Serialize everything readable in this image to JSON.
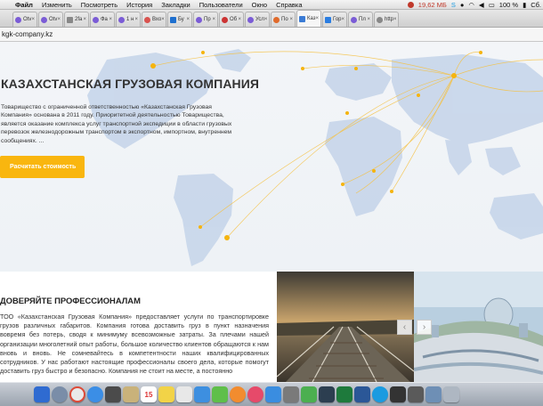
{
  "menubar": {
    "items": [
      "Файл",
      "Изменить",
      "Посмотреть",
      "История",
      "Закладки",
      "Пользователи",
      "Окно",
      "Справка"
    ],
    "memory": "19,62 МБ",
    "battery": "100 %",
    "day": "Сб."
  },
  "tabs": [
    {
      "label": "Otv",
      "color": "#7b5cd6"
    },
    {
      "label": "Otv",
      "color": "#7b5cd6"
    },
    {
      "label": "2fa",
      "color": "#888888"
    },
    {
      "label": "Фа",
      "color": "#7b5cd6"
    },
    {
      "label": "1 н",
      "color": "#7b5cd6"
    },
    {
      "label": "Вхо",
      "color": "#d9534f"
    },
    {
      "label": "Бу",
      "color": "#1e6fcf"
    },
    {
      "label": "Пр",
      "color": "#7b5cd6"
    },
    {
      "label": "Об",
      "color": "#cc3333"
    },
    {
      "label": "Усл",
      "color": "#7b5cd6"
    },
    {
      "label": "По",
      "color": "#e06a2b"
    },
    {
      "label": "Каз",
      "color": "#3a7bd5",
      "active": true
    },
    {
      "label": "Гор",
      "color": "#2a7de1"
    },
    {
      "label": "Пл",
      "color": "#7b5cd6"
    },
    {
      "label": "http",
      "color": "#888888"
    }
  ],
  "address": {
    "url": "kgk-company.kz"
  },
  "hero": {
    "title": "КАЗАХСТАНСКАЯ ГРУЗОВАЯ КОМПАНИЯ",
    "description": "Товарищество с ограниченной ответственностью «Казахстанская Грузовая Компания» основана в 2011 году. Приоритетной деятельностью Товарищества, является оказание комплекса услуг транспортной экспедиции в области грузовых перевозок железнодорожным транспортом в экспортном, импортном, внутреннем сообщениях. ...",
    "cta": "Расчитать стоимость",
    "accent": "#f9b60f"
  },
  "section": {
    "title": "ДОВЕРЯЙТЕ ПРОФЕССИОНАЛАМ",
    "body": "ТОО «Казахстанская Грузовая Компания» предоставляет услуги по транспортировке грузов различных габаритов. Компания готова доставить груз в пункт назначения вовремя без потерь, сводя к минимуму всевозможные затраты. За плечами нашей организации многолетний опыт работы, большое количество клиентов обращаются к нам вновь и вновь. Не сомневайтесь в компетентности наших квалифицированных сотрудников. У нас работают настоящие профессионалы своего дела, которые помогут доставить груз быстро и безопасно. Компания не стоит на месте, а постоянно"
  },
  "slider": {
    "prev": "‹",
    "next": "›"
  },
  "dock": {
    "calendar_day": "15"
  }
}
